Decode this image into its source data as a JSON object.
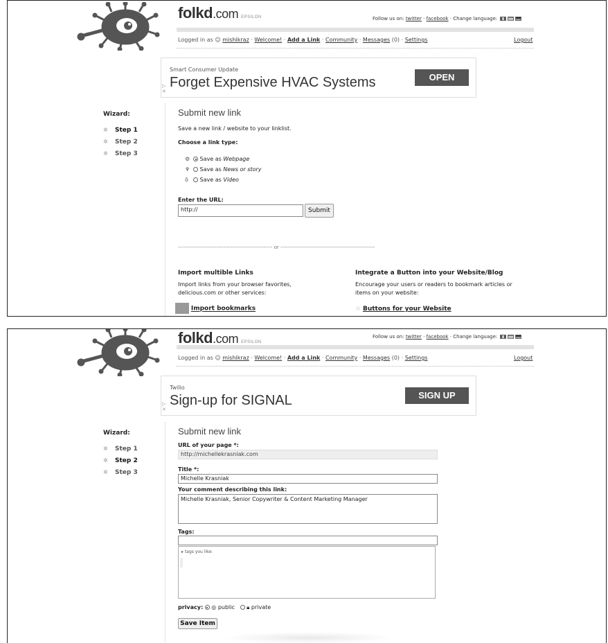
{
  "header": {
    "logo_main": "folkd",
    "logo_dotcom": ".com",
    "logo_tag": "EPSILON",
    "follow_label": "Follow us on:",
    "twitter": "twitter",
    "facebook": "facebook",
    "change_language": "Change language:",
    "logged_in_as": "Logged in as",
    "username": "mishikraz",
    "welcome": "Welcome!",
    "add_link": "Add a Link",
    "community": "Community",
    "messages": "Messages",
    "messages_count": "(0)",
    "settings": "Settings",
    "logout": "Logout"
  },
  "wizard": {
    "title": "Wizard:",
    "steps": [
      "Step 1",
      "Step 2",
      "Step 3"
    ]
  },
  "panel1": {
    "ad": {
      "sponsor": "Smart Consumer Update",
      "headline": "Forget Expensive HVAC Systems",
      "cta": "OPEN"
    },
    "title": "Submit new link",
    "intro": "Save a new link / website to your linklist.",
    "choose_type": "Choose a link type:",
    "types": [
      {
        "prefix": "Save as",
        "label": "Webpage",
        "selected": true
      },
      {
        "prefix": "Save as",
        "label": "News or story",
        "selected": false
      },
      {
        "prefix": "Save as",
        "label": "Video",
        "selected": false
      }
    ],
    "url_label": "Enter the URL:",
    "url_value": "http://",
    "submit": "Submit",
    "or": "or",
    "import_title": "Import multible Links",
    "import_text1": "Import links from your browser favorites,",
    "import_text2": "delicious.com or other services:",
    "import_link": "Import bookmarks",
    "integrate_title": "Integrate a Button into your Website/Blog",
    "integrate_text1": "Encourage your users or readers to bookmark articles or",
    "integrate_text2": "items on your website:",
    "integrate_link": "Buttons for your Website"
  },
  "panel2": {
    "ad": {
      "sponsor": "Twilio",
      "headline": "Sign-up for SIGNAL",
      "cta": "SIGN UP"
    },
    "title": "Submit new link",
    "url_label": "URL of your page *:",
    "url_value": "http://michellekrasniak.com",
    "title_label": "Title *:",
    "title_value": "Michelle Krasniak",
    "comment_label": "Your comment describing this link:",
    "comment_value": "Michelle Krasniak, Senior Copywriter & Content Marketing Manager",
    "tags_label": "Tags:",
    "tags_value": "",
    "tags_you_like": "tags you like:",
    "privacy_label": "privacy:",
    "public": "public",
    "private": "private",
    "save": "Save Item"
  },
  "colors": {
    "ad_button": "#555555",
    "divider": "#e2e2e2"
  }
}
